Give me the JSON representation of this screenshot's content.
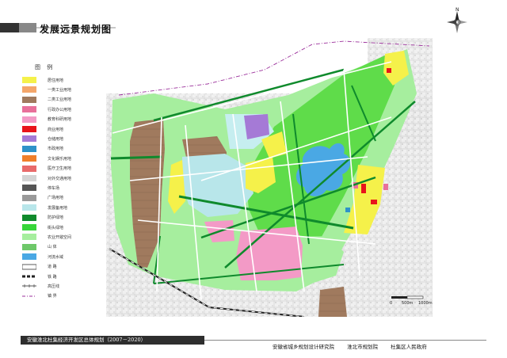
{
  "header": {
    "title": "发展远景规划图",
    "north_label": "N"
  },
  "legend": {
    "title": "图  例",
    "items": [
      {
        "label": "居住用地",
        "color": "#f5f14a",
        "style": "fill"
      },
      {
        "label": "一类工业用地",
        "color": "#f4a66a",
        "style": "fill"
      },
      {
        "label": "二类工业用地",
        "color": "#a07a5e",
        "style": "fill"
      },
      {
        "label": "行政办公用地",
        "color": "#e8709a",
        "style": "fill"
      },
      {
        "label": "教育科研用地",
        "color": "#f39ac6",
        "style": "fill"
      },
      {
        "label": "商业用地",
        "color": "#e8141b",
        "style": "fill"
      },
      {
        "label": "仓储用地",
        "color": "#a57ad6",
        "style": "fill"
      },
      {
        "label": "市政用地",
        "color": "#2e92c9",
        "style": "fill"
      },
      {
        "label": "文化娱乐用地",
        "color": "#f07f2a",
        "style": "fill"
      },
      {
        "label": "医疗卫生用地",
        "color": "#e86a6a",
        "style": "fill"
      },
      {
        "label": "对外交通用地",
        "color": "#d4d4d4",
        "style": "fill"
      },
      {
        "label": "停车场",
        "color": "#555555",
        "style": "fill"
      },
      {
        "label": "广场用地",
        "color": "#9a9a9a",
        "style": "fill"
      },
      {
        "label": "发展备用地",
        "color": "#b8e6ea",
        "style": "fill"
      },
      {
        "label": "防护绿地",
        "color": "#0f8a2c",
        "style": "fill"
      },
      {
        "label": "街头绿地",
        "color": "#38d63a",
        "style": "fill"
      },
      {
        "label": "农业开敞空间",
        "color": "#a6ee9e",
        "style": "fill"
      },
      {
        "label": "山  体",
        "color": "#6ec86a",
        "style": "fill"
      },
      {
        "label": "河流水域",
        "color": "#4aa8e4",
        "style": "fill"
      },
      {
        "label": "道  路",
        "color": "#ffffff",
        "style": "road"
      },
      {
        "label": "铁  路",
        "color": "#222222",
        "style": "rail"
      },
      {
        "label": "高压线",
        "color": "#555555",
        "style": "power"
      },
      {
        "label": "镇  界",
        "color": "#9b2f9b",
        "style": "boundary"
      }
    ]
  },
  "scale_bar": {
    "labels": [
      "0",
      "500m",
      "1000m"
    ]
  },
  "footer": {
    "project_title": "安徽淮北杜集经济开发区总体规划（2007－2020）",
    "organizations": [
      "安徽省城乡规划设计研究院",
      "淮北市规划院",
      "杜集区人民政府"
    ]
  }
}
